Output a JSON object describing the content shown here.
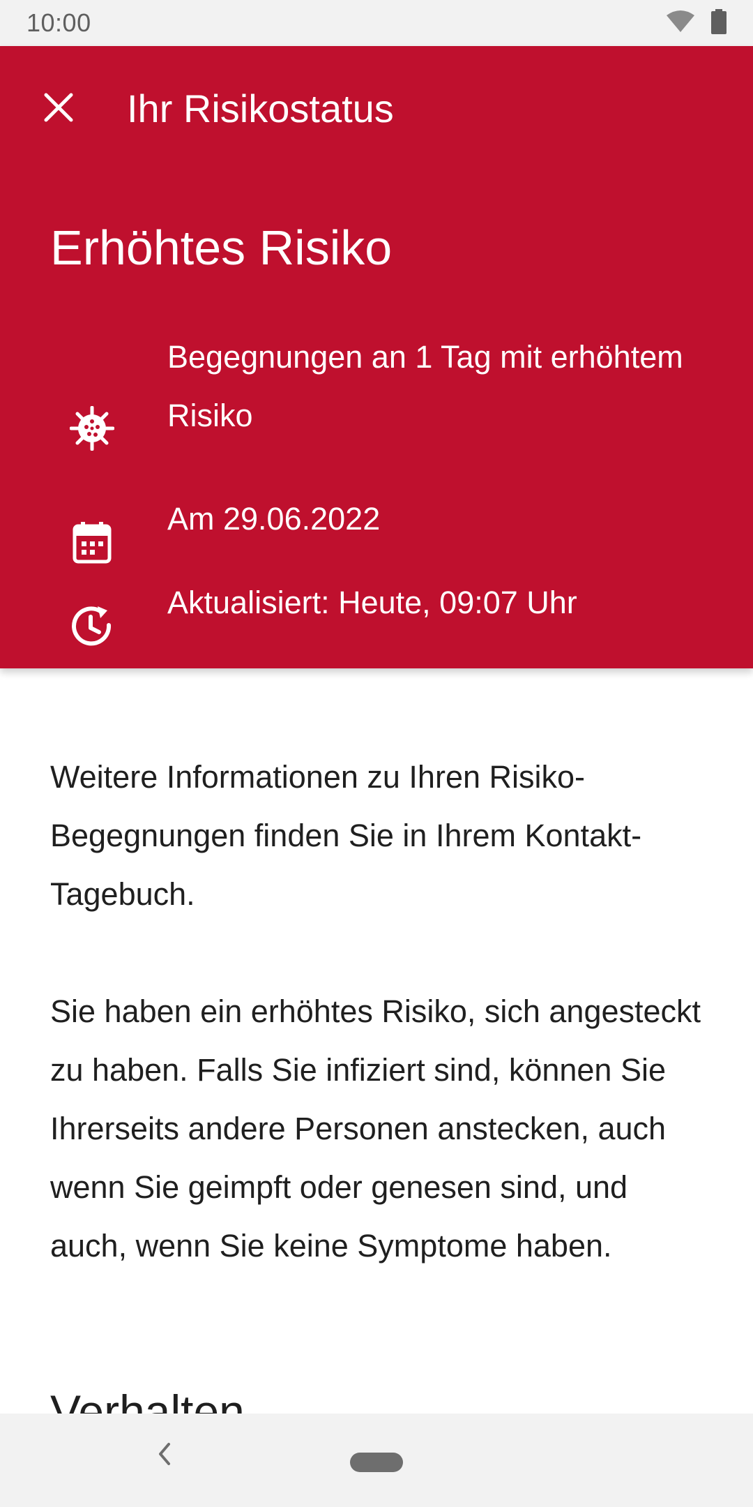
{
  "status_bar": {
    "time": "10:00",
    "icons": [
      "wifi-icon",
      "battery-icon"
    ]
  },
  "header": {
    "title": "Ihr Risikostatus",
    "close_icon": "close-icon",
    "background_color": "#bf102e",
    "risk_level": "Erhöhtes Risiko",
    "rows": [
      {
        "icon": "virus-icon",
        "text": "Begegnungen an 1 Tag mit erhöhtem Risiko"
      },
      {
        "icon": "calendar-icon",
        "text": "Am 29.06.2022"
      },
      {
        "icon": "clock-update-icon",
        "text": "Aktualisiert: Heute, 09:07 Uhr"
      }
    ]
  },
  "body": {
    "paragraphs": [
      "Weitere Informationen zu Ihren Risiko-Begegnungen finden Sie in Ihrem Kontakt-Tagebuch.",
      "Sie haben ein erhöhtes Risiko, sich angesteckt zu haben. Falls Sie infiziert sind, können Sie Ihrerseits andere Personen anstecken, auch wenn Sie geimpft oder genesen sind, und auch, wenn Sie keine Symptome haben."
    ],
    "section_heading": "Verhalten"
  },
  "nav_bar": {
    "back_icon": "back-chevron-icon",
    "home_icon": "home-pill-icon"
  }
}
